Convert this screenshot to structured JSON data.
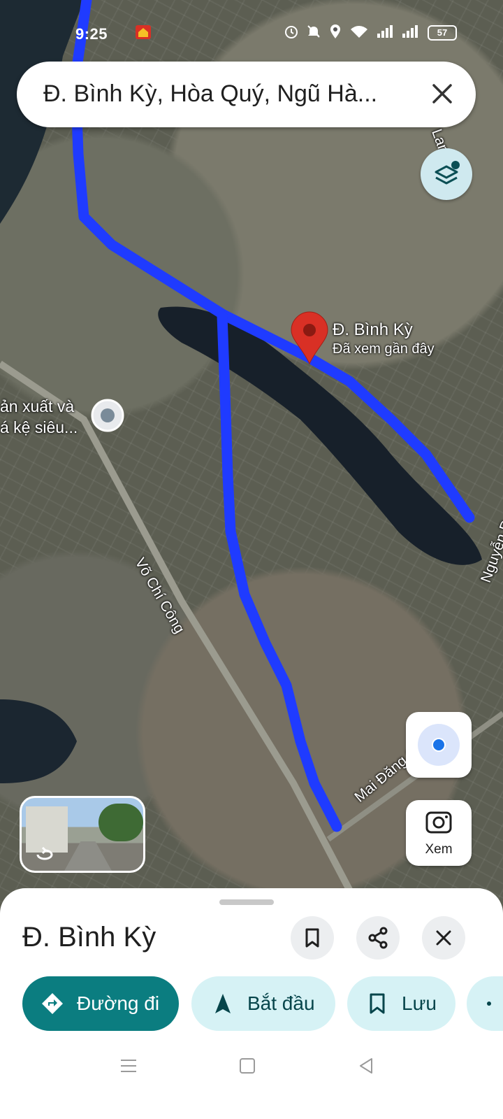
{
  "status_bar": {
    "time": "9:25",
    "battery": "57"
  },
  "search": {
    "query": "Đ. Bình Kỳ, Hòa Quý, Ngũ Hà..."
  },
  "map": {
    "pin": {
      "title": "Đ. Bình Kỳ",
      "subtitle": "Đã xem gần đây"
    },
    "poi_label_line1": "ản xuất và",
    "poi_label_line2": "á kệ siêu...",
    "streets": {
      "vo_chi_cong": "Võ Chí Công",
      "mai_dang": "Mai Đăng C...",
      "nguyen": "Nguyễn P...",
      "lan": "Lan"
    },
    "route_color": "#1f3bff"
  },
  "controls": {
    "xem_label": "Xem"
  },
  "sheet": {
    "title": "Đ. Bình Kỳ",
    "actions": {
      "directions": "Đường đi",
      "start": "Bắt đầu",
      "save": "Lưu"
    }
  },
  "colors": {
    "primary": "#0b7d80",
    "chip_bg": "#d6f2f5",
    "pin": "#d93025"
  }
}
